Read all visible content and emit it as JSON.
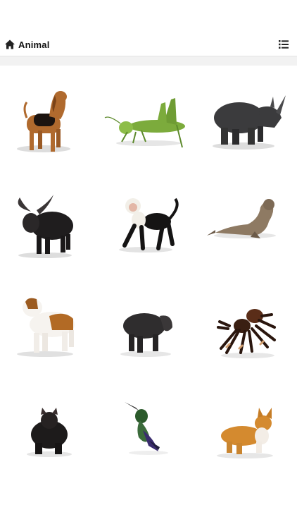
{
  "header": {
    "title": "Animal",
    "home_icon": "home-icon",
    "menu_icon": "list-icon"
  },
  "animals": [
    {
      "name": "bloodhound"
    },
    {
      "name": "grasshopper"
    },
    {
      "name": "rhinoceros"
    },
    {
      "name": "water-buffalo"
    },
    {
      "name": "capuchin-monkey"
    },
    {
      "name": "sea-lion"
    },
    {
      "name": "saint-bernard"
    },
    {
      "name": "tapir"
    },
    {
      "name": "tarantula"
    },
    {
      "name": "tasmanian-devil"
    },
    {
      "name": "hummingbird"
    },
    {
      "name": "corgi"
    }
  ]
}
